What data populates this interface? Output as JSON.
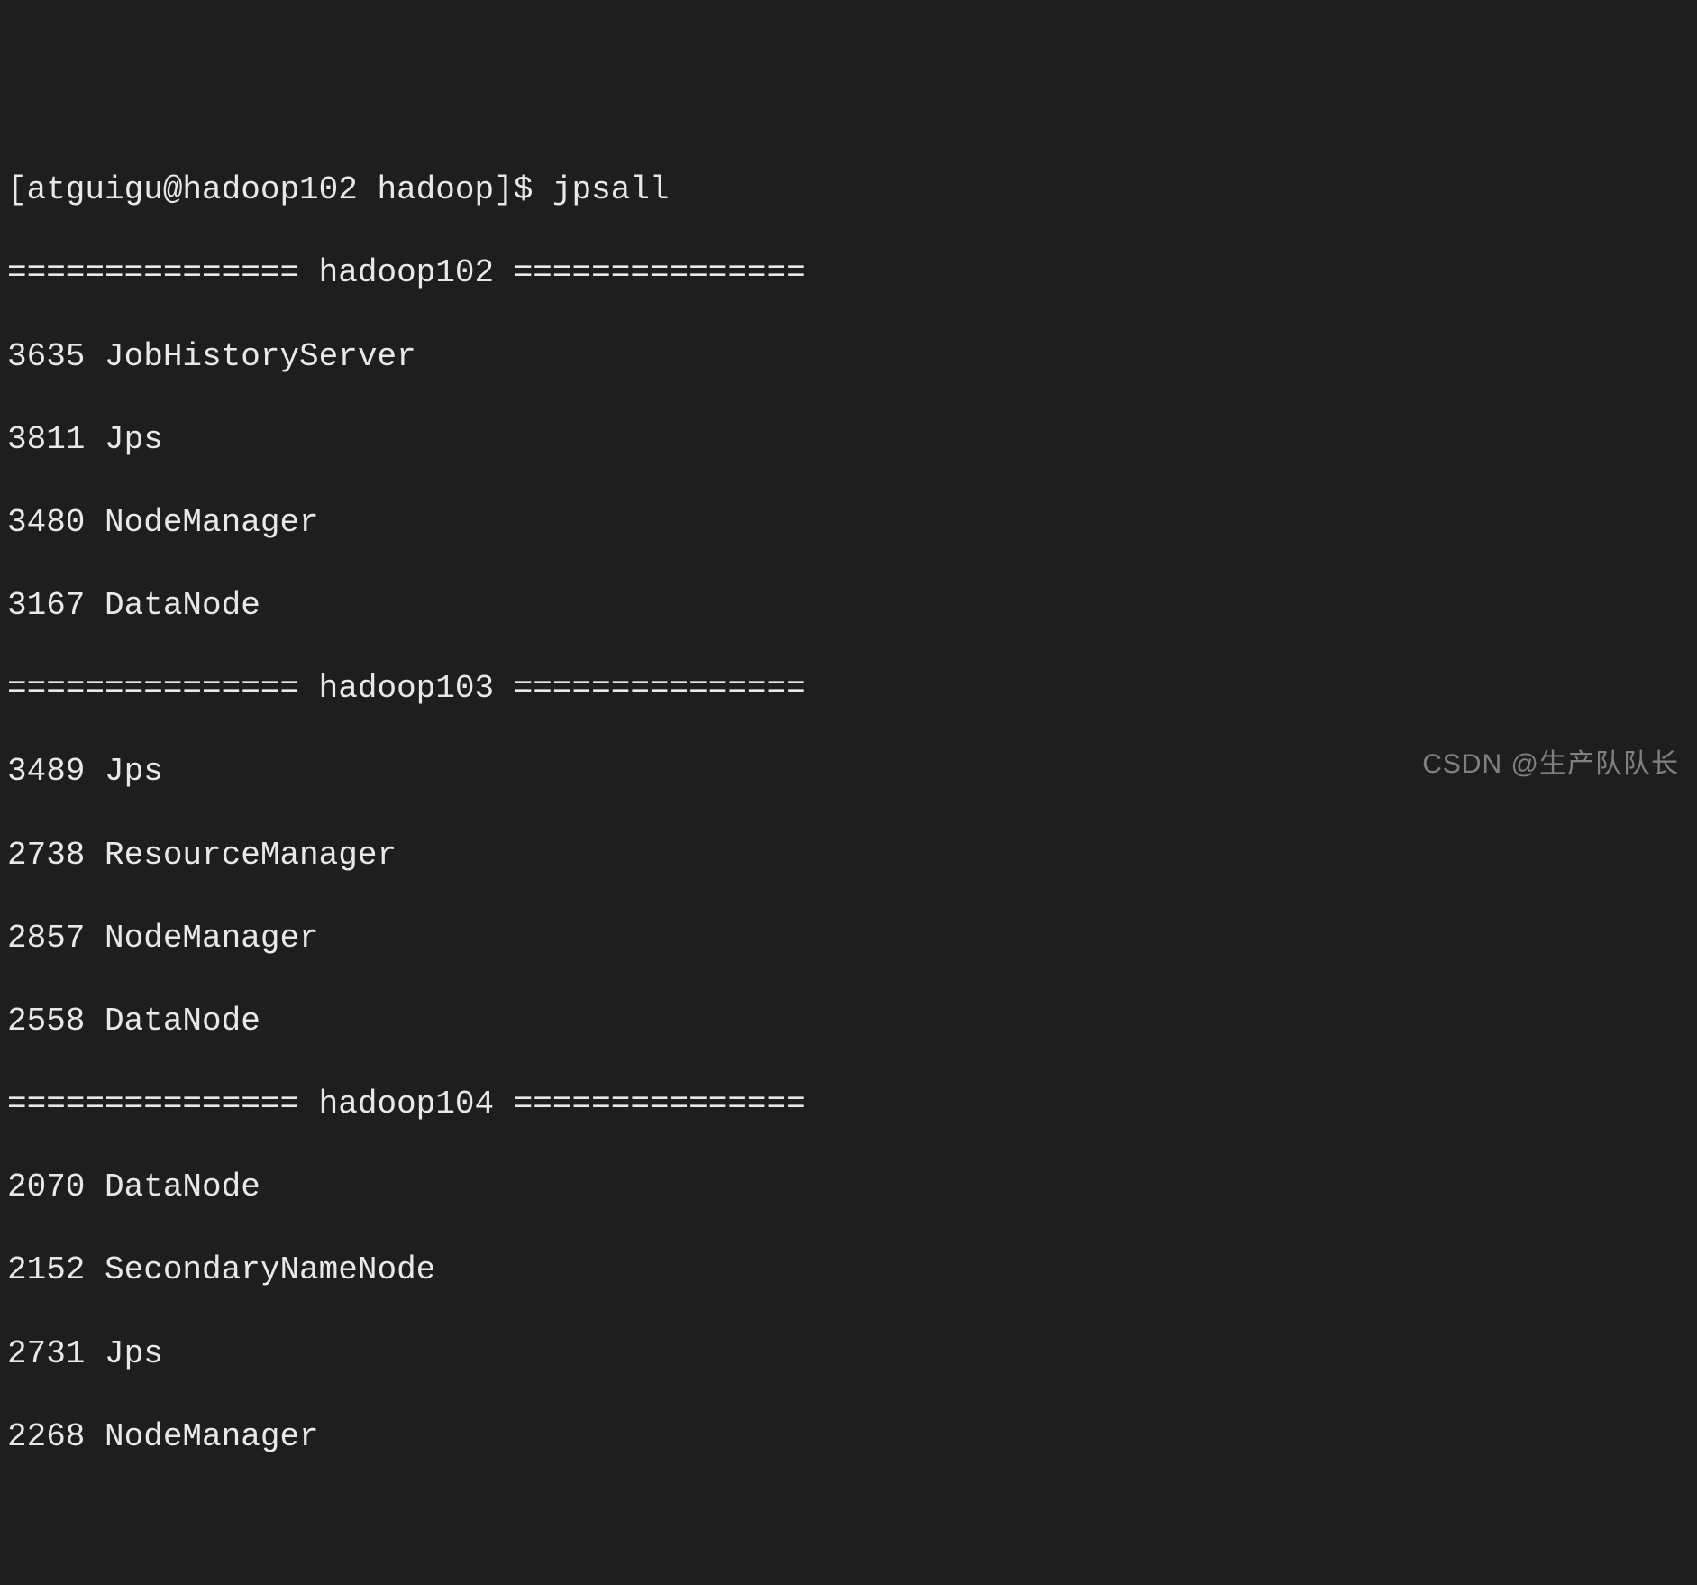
{
  "prompt": "[atguigu@hadoop102 hadoop]$ jpsall",
  "hosts": [
    {
      "header": "=============== hadoop102 ===============",
      "processes": [
        "3635 JobHistoryServer",
        "3811 Jps",
        "3480 NodeManager",
        "3167 DataNode"
      ]
    },
    {
      "header": "=============== hadoop103 ===============",
      "processes": [
        "3489 Jps",
        "2738 ResourceManager",
        "2857 NodeManager",
        "2558 DataNode"
      ]
    },
    {
      "header": "=============== hadoop104 ===============",
      "processes": [
        "2070 DataNode",
        "2152 SecondaryNameNode",
        "2731 Jps",
        "2268 NodeManager"
      ]
    }
  ],
  "watermark": "CSDN @生产队队长"
}
